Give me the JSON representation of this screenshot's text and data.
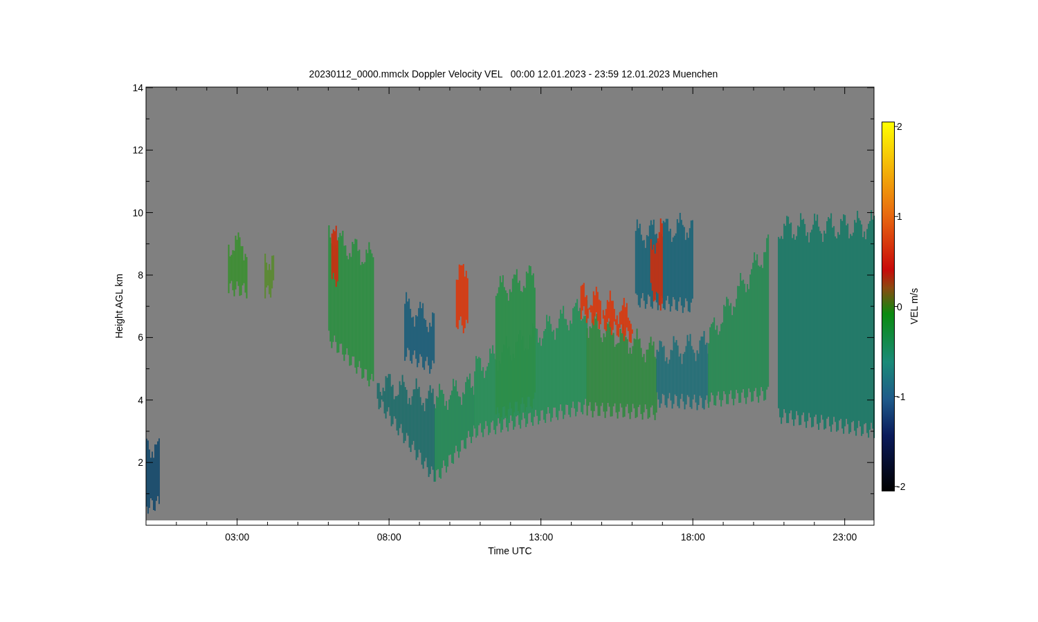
{
  "title": "20230112_0000.mmclx Doppler Velocity VEL   00:00 12.01.2023 - 23:59 12.01.2023 Muenchen",
  "y_axis": {
    "label": "Height AGL km",
    "ticks": [
      "14",
      "12",
      "10",
      "8",
      "6",
      "4",
      "2"
    ]
  },
  "x_axis": {
    "label": "Time UTC",
    "ticks": [
      "03:00",
      "08:00",
      "13:00",
      "18:00",
      "23:00"
    ]
  },
  "colorbar": {
    "label": "VEL m/s",
    "ticks": [
      "2",
      "1",
      "0",
      "-1",
      "-2"
    ]
  }
}
